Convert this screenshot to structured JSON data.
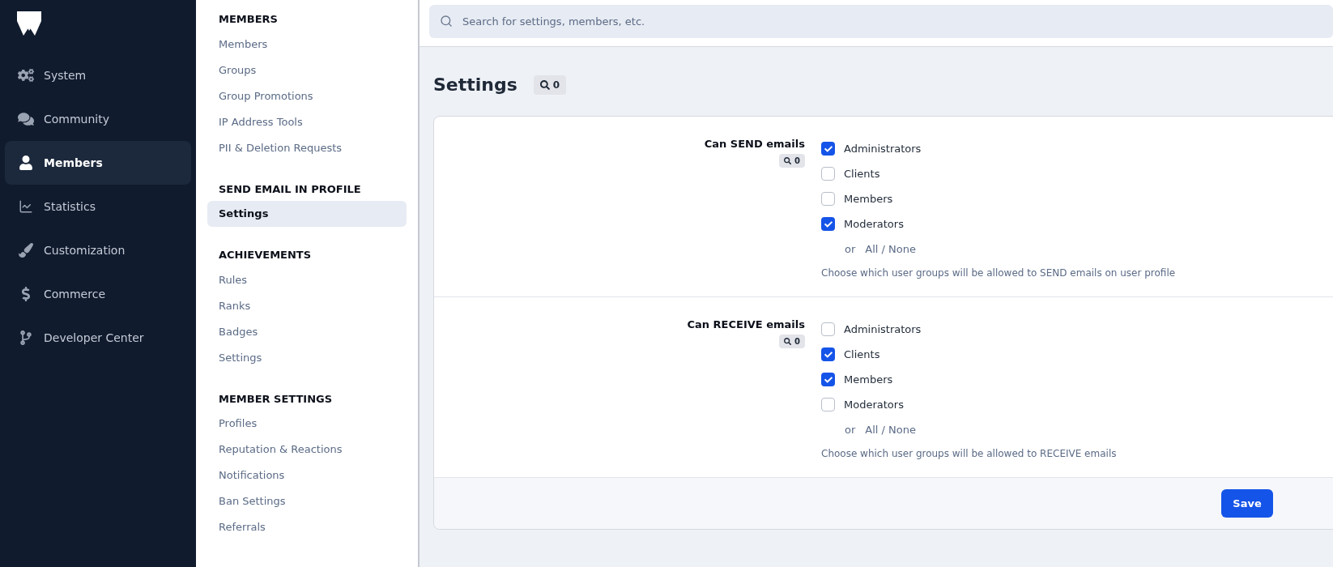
{
  "nav": [
    {
      "label": "System",
      "selected": false
    },
    {
      "label": "Community",
      "selected": false
    },
    {
      "label": "Members",
      "selected": true
    },
    {
      "label": "Statistics",
      "selected": false
    },
    {
      "label": "Customization",
      "selected": false
    },
    {
      "label": "Commerce",
      "selected": false
    },
    {
      "label": "Developer Center",
      "selected": false
    }
  ],
  "subnav": [
    {
      "heading": "MEMBERS",
      "items": [
        {
          "label": "Members",
          "selected": false
        },
        {
          "label": "Groups",
          "selected": false
        },
        {
          "label": "Group Promotions",
          "selected": false
        },
        {
          "label": "IP Address Tools",
          "selected": false
        },
        {
          "label": "PII & Deletion Requests",
          "selected": false
        }
      ]
    },
    {
      "heading": "SEND EMAIL IN PROFILE",
      "items": [
        {
          "label": "Settings",
          "selected": true
        }
      ]
    },
    {
      "heading": "ACHIEVEMENTS",
      "items": [
        {
          "label": "Rules",
          "selected": false
        },
        {
          "label": "Ranks",
          "selected": false
        },
        {
          "label": "Badges",
          "selected": false
        },
        {
          "label": "Settings",
          "selected": false
        }
      ]
    },
    {
      "heading": "MEMBER SETTINGS",
      "items": [
        {
          "label": "Profiles",
          "selected": false
        },
        {
          "label": "Reputation & Reactions",
          "selected": false
        },
        {
          "label": "Notifications",
          "selected": false
        },
        {
          "label": "Ban Settings",
          "selected": false
        },
        {
          "label": "Referrals",
          "selected": false
        }
      ]
    }
  ],
  "search": {
    "placeholder": "Search for settings, members, etc."
  },
  "page": {
    "title": "Settings",
    "search_count": "0"
  },
  "settings": [
    {
      "label": "Can SEND emails",
      "search_count": "0",
      "options": [
        {
          "label": "Administrators",
          "checked": true
        },
        {
          "label": "Clients",
          "checked": false
        },
        {
          "label": "Members",
          "checked": false
        },
        {
          "label": "Moderators",
          "checked": true
        }
      ],
      "or": "or",
      "all_none": "All / None",
      "description": "Choose which user groups will be allowed to SEND emails on user profile"
    },
    {
      "label": "Can RECEIVE emails",
      "search_count": "0",
      "options": [
        {
          "label": "Administrators",
          "checked": false
        },
        {
          "label": "Clients",
          "checked": true
        },
        {
          "label": "Members",
          "checked": true
        },
        {
          "label": "Moderators",
          "checked": false
        }
      ],
      "or": "or",
      "all_none": "All / None",
      "description": "Choose which user groups will be allowed to RECEIVE emails"
    }
  ],
  "save_button": "Save"
}
